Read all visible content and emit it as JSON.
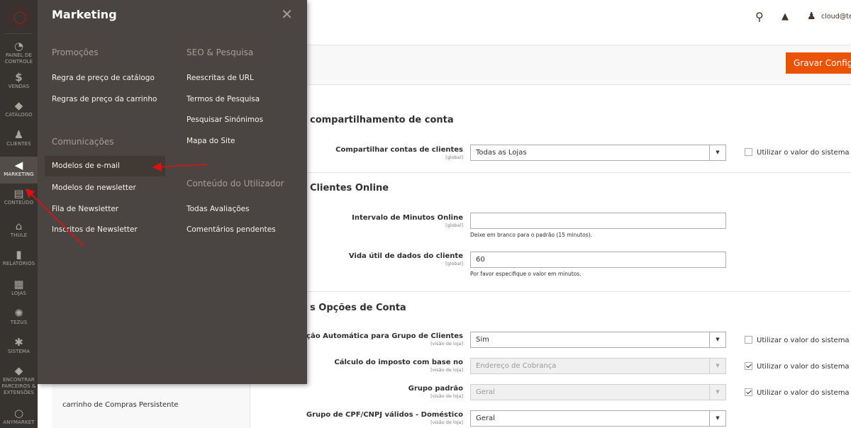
{
  "nav": {
    "items": [
      {
        "label": "PAINEL DE CONTROLE",
        "icon": "dashboard-icon",
        "glyph": "◔"
      },
      {
        "label": "VENDAS",
        "icon": "dollar-icon",
        "glyph": "$"
      },
      {
        "label": "CATÁLOGO",
        "icon": "cube-icon",
        "glyph": "◆"
      },
      {
        "label": "CLIENTES",
        "icon": "person-icon",
        "glyph": "♟"
      },
      {
        "label": "MARKETING",
        "icon": "megaphone-icon",
        "glyph": "◀"
      },
      {
        "label": "CONTEÚDO",
        "icon": "content-icon",
        "glyph": "▤"
      },
      {
        "label": "THULE",
        "icon": "thule-icon",
        "glyph": "⌂"
      },
      {
        "label": "RELATÓRIOS",
        "icon": "bar-chart-icon",
        "glyph": "▮"
      },
      {
        "label": "LOJAS",
        "icon": "store-icon",
        "glyph": "▦"
      },
      {
        "label": "TEZUS",
        "icon": "tezus-icon",
        "glyph": "✺"
      },
      {
        "label": "SISTEMA",
        "icon": "gear-icon",
        "glyph": "✱"
      },
      {
        "label": "ENCONTRAR PARCEIROS & EXTENSÕES",
        "icon": "extensions-icon",
        "glyph": "◆"
      },
      {
        "label": "ANYMARKET",
        "icon": "anymarket-icon",
        "glyph": "○"
      }
    ],
    "active_color": "#524d49"
  },
  "flyout": {
    "title": "Marketing",
    "close_glyph": "✕",
    "groups": {
      "promocoes": {
        "heading": "Promoções",
        "links": [
          "Regra de preço de catálogo",
          "Regras de preço da carrinho"
        ]
      },
      "comunicacoes": {
        "heading": "Comunicações",
        "links": [
          "Modelos de e-mail",
          "Modelos de newsletter",
          "Fila de Newsletter",
          "Inscritos de Newsletter"
        ]
      },
      "seo": {
        "heading": "SEO & Pesquisa",
        "links": [
          "Reescritas de URL",
          "Termos de Pesquisa",
          "Pesquisar Sinónimos",
          "Mapa do Site"
        ]
      },
      "conteudo": {
        "heading": "Conteúdo do Utilizador",
        "links": [
          "Todas Avaliações",
          "Comentários pendentes"
        ]
      }
    }
  },
  "header": {
    "user": "cloud@tezu",
    "save_label": "Gravar Configu",
    "accent": "#eb5202"
  },
  "sections": {
    "account_sharing": {
      "title": "compartilhamento de conta",
      "fields": {
        "share": {
          "label": "Compartilhar contas de clientes",
          "scope": "[global]",
          "value": "Todas as Lojas",
          "system": "Utilizar o valor do sistema"
        }
      }
    },
    "online_customers": {
      "title": "Clientes Online",
      "fields": {
        "interval": {
          "label": "Intervalo de Minutos Online",
          "scope": "[global]",
          "value": "",
          "note": "Deixe em branco para o padrão (15 minutos)."
        },
        "lifetime": {
          "label": "Vida útil de dados do cliente",
          "scope": "[global]",
          "value": "60",
          "note": "Por favor especifique o valor em minutos."
        }
      }
    },
    "account_options": {
      "title": "s Opções de Conta",
      "fields": {
        "auto_group": {
          "label": "r a Atribuição Automática para Grupo de Clientes",
          "scope": "[visão de loja]",
          "value": "Sim",
          "system": "Utilizar o valor do sistema"
        },
        "tax_calc": {
          "label": "Cálculo do imposto com base no",
          "scope": "[visão de loja]",
          "value": "Endereço de Cobrança",
          "system": "Utilizar o valor do sistema"
        },
        "default_group": {
          "label": "Grupo padrão",
          "scope": "[visão de loja]",
          "value": "Geral",
          "system": "Utilizar o valor do sistema"
        },
        "cpf_group": {
          "label": "Grupo de CPF/CNPJ válidos - Doméstico",
          "scope": "[visão de loja]",
          "value": "Geral"
        }
      }
    }
  },
  "left_panel": {
    "item": "carrinho de Compras Persistente"
  },
  "annotation_color": "#e01010"
}
